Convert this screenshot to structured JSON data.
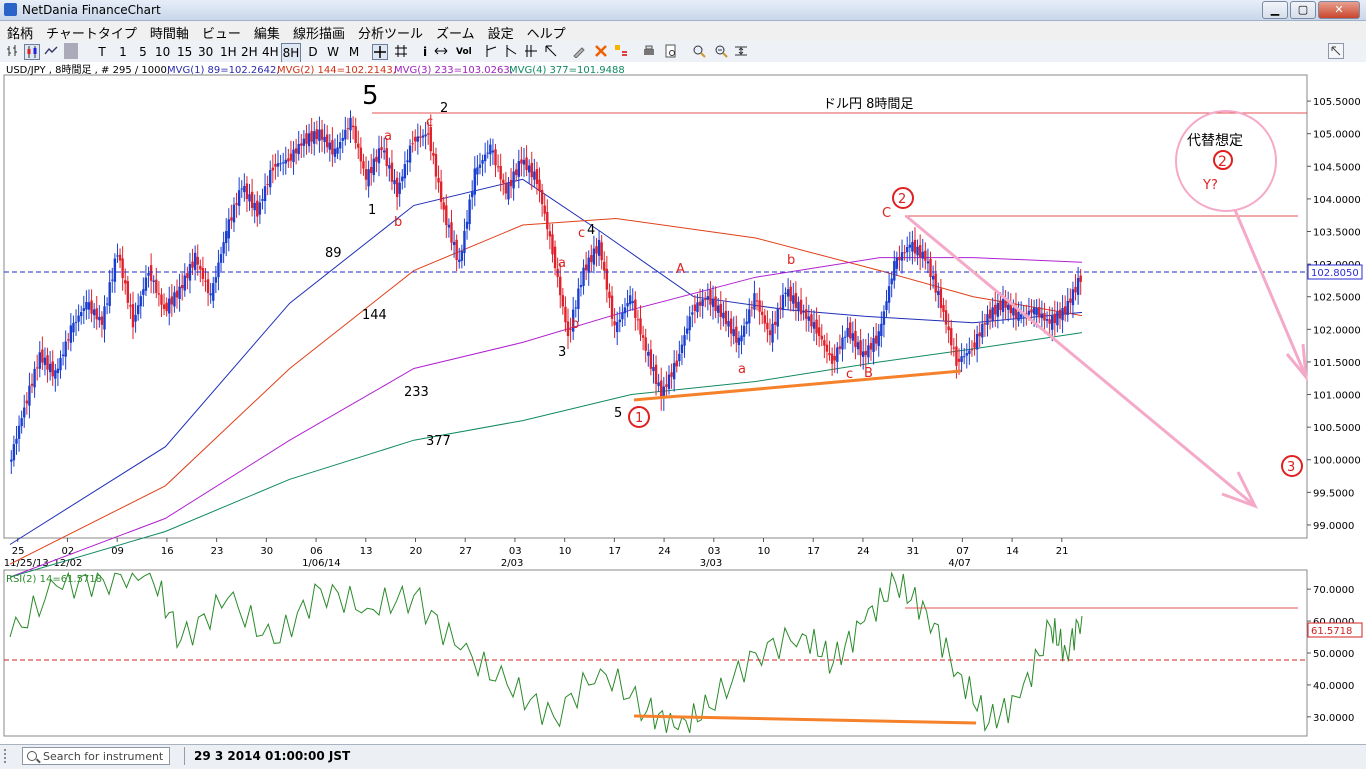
{
  "window": {
    "title": "NetDania FinanceChart",
    "btn_min": "▁",
    "btn_max": "▢",
    "btn_close": "✕"
  },
  "menu": [
    "銘柄",
    "チャートタイプ",
    "時間軸",
    "ビュー",
    "編集",
    "線形描画",
    "分析ツール",
    "ズーム",
    "設定",
    "ヘルプ"
  ],
  "toolbar": {
    "periods": [
      "T",
      "1",
      "5",
      "10",
      "15",
      "30",
      "1H",
      "2H",
      "4H",
      "8H",
      "D",
      "W",
      "M"
    ],
    "selected": "8H",
    "icons": [
      "bar-chart-icon",
      "candle-icon",
      "line-chart-icon",
      "crosshair-icon",
      "grid-icon",
      "info-icon",
      "arrows-icon",
      "volume-icon",
      "cursor-icon",
      "cursor2-icon",
      "cursor3-icon",
      "cursor4-icon",
      "pencil-icon",
      "delete-icon",
      "properties-icon",
      "print-icon",
      "preview-icon",
      "zoom-in-icon",
      "zoom-out-icon",
      "zoom-fit-icon",
      "expand-icon"
    ],
    "volume_label": "Vol",
    "info_label": "i"
  },
  "chart_header": {
    "symbol": "USD/JPY , 8時間足 , # 295 / 1000,",
    "mvg1": "MVG(1) 89=102.2642,",
    "mvg2": "MVG(2) 144=102.2143,",
    "mvg3": "MVG(3) 233=103.0263,",
    "mvg4": "MVG(4) 377=101.9488"
  },
  "colors": {
    "up": "#1a3fd0",
    "down": "#e0202a",
    "ma89": "#1e2fb8",
    "ma144": "#e0401a",
    "ma233": "#b020d0",
    "ma377": "#108a60",
    "annotation": "#f5a9c8",
    "trend": "#f5822a",
    "rsi": "#2a8a2a",
    "level_red": "#e05050"
  },
  "chart_data": [
    {
      "type": "line",
      "title": "ドル円 8時間足",
      "ylim": [
        98.8,
        105.9
      ],
      "y_ticks": [
        "105.5000",
        "105.0000",
        "104.5000",
        "104.0000",
        "103.5000",
        "103.0000",
        "102.5000",
        "102.0000",
        "101.5000",
        "101.0000",
        "100.5000",
        "100.0000",
        "99.5000",
        "99.0000"
      ],
      "x_ticks": [
        "25",
        "02",
        "09",
        "16",
        "23",
        "30",
        "06",
        "13",
        "20",
        "27",
        "03",
        "10",
        "17",
        "24",
        "03",
        "10",
        "17",
        "24",
        "31",
        "07",
        "14",
        "21"
      ],
      "x_sublabels": [
        "11/25/13",
        "12/02",
        "1/06/14",
        "2/03",
        "3/03",
        "4/07"
      ],
      "last_price": "102.8050",
      "close_points": [
        [
          0,
          99.9
        ],
        [
          1,
          100.8
        ],
        [
          2,
          101.6
        ],
        [
          3,
          101.3
        ],
        [
          4,
          102.0
        ],
        [
          5,
          102.4
        ],
        [
          6,
          102.1
        ],
        [
          7,
          103.2
        ],
        [
          8,
          102.1
        ],
        [
          9,
          102.9
        ],
        [
          10,
          102.3
        ],
        [
          11,
          102.6
        ],
        [
          12,
          103.1
        ],
        [
          13,
          102.5
        ],
        [
          14,
          103.5
        ],
        [
          15,
          104.2
        ],
        [
          16,
          103.8
        ],
        [
          17,
          104.5
        ],
        [
          18,
          104.6
        ],
        [
          19,
          104.9
        ],
        [
          20,
          105.0
        ],
        [
          21,
          104.7
        ],
        [
          22,
          105.2
        ],
        [
          23,
          104.3
        ],
        [
          24,
          104.8
        ],
        [
          25,
          104.1
        ],
        [
          26,
          104.9
        ],
        [
          27,
          105.0
        ],
        [
          28,
          103.8
        ],
        [
          29,
          103.0
        ],
        [
          30,
          104.4
        ],
        [
          31,
          104.8
        ],
        [
          32,
          104.1
        ],
        [
          33,
          104.6
        ],
        [
          34,
          104.3
        ],
        [
          35,
          103.2
        ],
        [
          36,
          101.9
        ],
        [
          37,
          102.9
        ],
        [
          38,
          103.3
        ],
        [
          39,
          102.0
        ],
        [
          40,
          102.5
        ],
        [
          41,
          101.7
        ],
        [
          42,
          101.0
        ],
        [
          43,
          101.5
        ],
        [
          44,
          102.3
        ],
        [
          45,
          102.5
        ],
        [
          46,
          102.2
        ],
        [
          47,
          101.8
        ],
        [
          48,
          102.5
        ],
        [
          49,
          101.9
        ],
        [
          50,
          102.6
        ],
        [
          51,
          102.3
        ],
        [
          52,
          102.0
        ],
        [
          53,
          101.5
        ],
        [
          54,
          102.0
        ],
        [
          55,
          101.6
        ],
        [
          56,
          101.9
        ],
        [
          57,
          103.0
        ],
        [
          58,
          103.3
        ],
        [
          59,
          103.1
        ],
        [
          60,
          102.4
        ],
        [
          61,
          101.5
        ],
        [
          62,
          101.7
        ],
        [
          63,
          102.2
        ],
        [
          64,
          102.4
        ],
        [
          65,
          102.2
        ],
        [
          66,
          102.3
        ],
        [
          67,
          102.1
        ],
        [
          68,
          102.3
        ],
        [
          69,
          102.8
        ]
      ],
      "series": [
        {
          "name": "89",
          "values": [
            [
              0,
              98.7
            ],
            [
              10,
              100.2
            ],
            [
              18,
              102.4
            ],
            [
              26,
              103.9
            ],
            [
              33,
              104.3
            ],
            [
              38,
              103.5
            ],
            [
              44,
              102.5
            ],
            [
              50,
              102.3
            ],
            [
              55,
              102.2
            ],
            [
              62,
              102.1
            ],
            [
              69,
              102.26
            ]
          ]
        },
        {
          "name": "144",
          "values": [
            [
              0,
              98.4
            ],
            [
              10,
              99.6
            ],
            [
              18,
              101.4
            ],
            [
              26,
              102.9
            ],
            [
              33,
              103.6
            ],
            [
              39,
              103.7
            ],
            [
              48,
              103.4
            ],
            [
              56,
              102.9
            ],
            [
              62,
              102.5
            ],
            [
              69,
              102.21
            ]
          ]
        },
        {
          "name": "233",
          "values": [
            [
              0,
              98.2
            ],
            [
              10,
              99.1
            ],
            [
              18,
              100.3
            ],
            [
              26,
              101.4
            ],
            [
              33,
              101.8
            ],
            [
              40,
              102.3
            ],
            [
              48,
              102.8
            ],
            [
              56,
              103.1
            ],
            [
              62,
              103.1
            ],
            [
              69,
              103.03
            ]
          ]
        },
        {
          "name": "377",
          "values": [
            [
              0,
              98.2
            ],
            [
              10,
              98.9
            ],
            [
              18,
              99.7
            ],
            [
              26,
              100.3
            ],
            [
              33,
              100.6
            ],
            [
              40,
              101.0
            ],
            [
              48,
              101.2
            ],
            [
              56,
              101.5
            ],
            [
              62,
              101.7
            ],
            [
              69,
              101.95
            ]
          ]
        }
      ],
      "ma_labels": [
        "89",
        "144",
        "233",
        "377"
      ],
      "wave_labels": [
        "5",
        "2",
        "a",
        "c",
        "1",
        "b",
        "4",
        "c",
        "a",
        "b",
        "3",
        "5",
        "A",
        "b",
        "c",
        "B",
        "C",
        "a"
      ],
      "alt_labels": {
        "title": "代替想定",
        "circle2": "2",
        "y_note": "Y?"
      },
      "circled": [
        "1",
        "2",
        "3"
      ]
    },
    {
      "type": "line",
      "title": "RSI(2) 14=61.5718",
      "ylim": [
        24,
        76
      ],
      "y_ticks": [
        "70.0000",
        "60.0000",
        "50.0000",
        "40.0000",
        "30.0000"
      ],
      "last_value": "61.5718",
      "series": [
        {
          "name": "RSI(2) 14",
          "values": [
            [
              0,
              55
            ],
            [
              3,
              71
            ],
            [
              6,
              73
            ],
            [
              9,
              76
            ],
            [
              11,
              54
            ],
            [
              14,
              67
            ],
            [
              17,
              53
            ],
            [
              20,
              70
            ],
            [
              23,
              64
            ],
            [
              26,
              68
            ],
            [
              29,
              51
            ],
            [
              32,
              40
            ],
            [
              35,
              30
            ],
            [
              38,
              45
            ],
            [
              41,
              32
            ],
            [
              43,
              26
            ],
            [
              45,
              33
            ],
            [
              48,
              50
            ],
            [
              51,
              56
            ],
            [
              53,
              47
            ],
            [
              55,
              60
            ],
            [
              57,
              72
            ],
            [
              59,
              63
            ],
            [
              61,
              44
            ],
            [
              63,
              28
            ],
            [
              65,
              36
            ],
            [
              67,
              58
            ],
            [
              68,
              50
            ],
            [
              69,
              61.57
            ]
          ]
        }
      ]
    }
  ],
  "status": {
    "search_placeholder": "Search for instrument",
    "datetime": "29 3 2014 01:00:00 JST"
  }
}
